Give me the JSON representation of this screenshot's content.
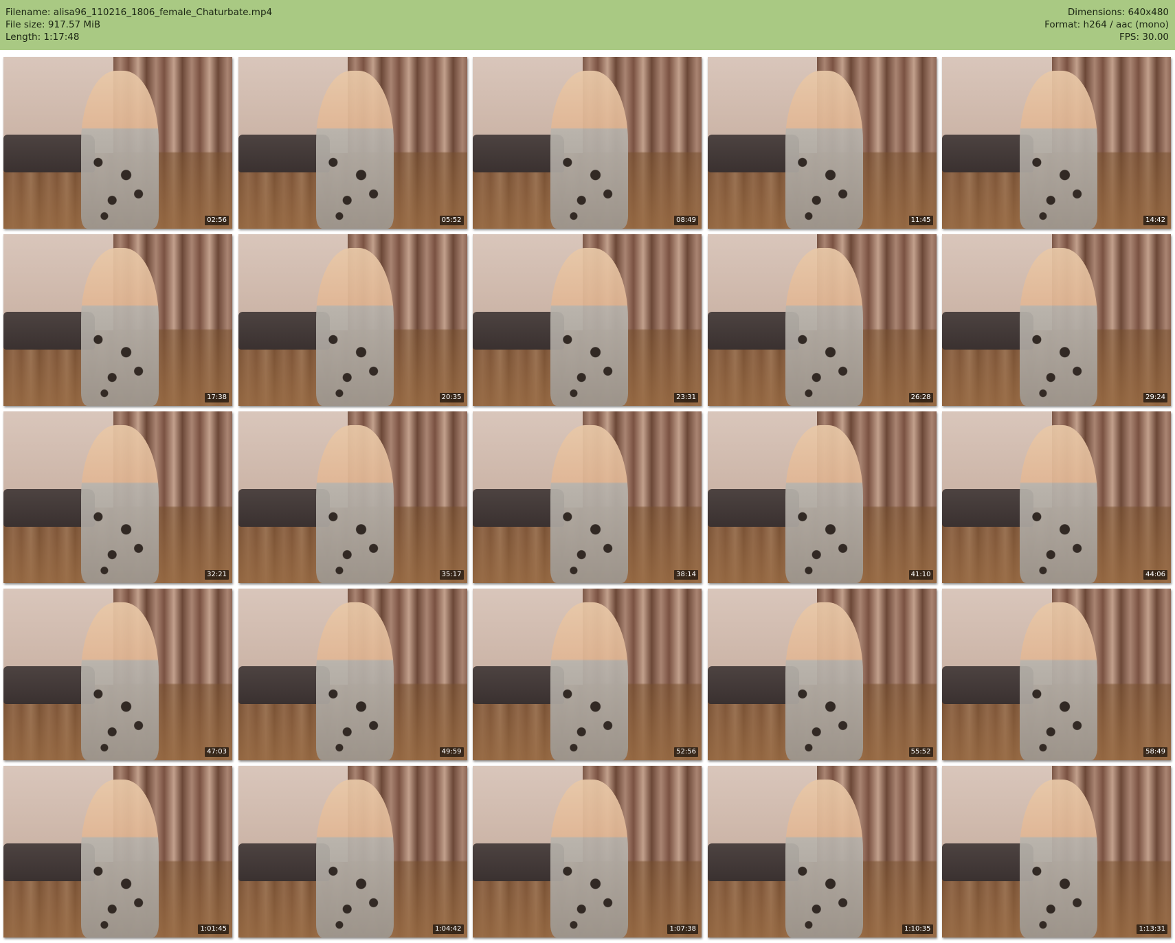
{
  "header": {
    "left": [
      "Filename: alisa96_110216_1806_female_Chaturbate.mp4",
      "File size: 917.57 MiB",
      "Length: 1:17:48"
    ],
    "right": [
      "Dimensions: 640x480",
      "Format: h264 / aac (mono)",
      "FPS: 30.00"
    ]
  },
  "thumbnails": [
    {
      "time": "02:56"
    },
    {
      "time": "05:52"
    },
    {
      "time": "08:49"
    },
    {
      "time": "11:45"
    },
    {
      "time": "14:42"
    },
    {
      "time": "17:38"
    },
    {
      "time": "20:35"
    },
    {
      "time": "23:31"
    },
    {
      "time": "26:28"
    },
    {
      "time": "29:24"
    },
    {
      "time": "32:21"
    },
    {
      "time": "35:17"
    },
    {
      "time": "38:14"
    },
    {
      "time": "41:10"
    },
    {
      "time": "44:06"
    },
    {
      "time": "47:03"
    },
    {
      "time": "49:59"
    },
    {
      "time": "52:56"
    },
    {
      "time": "55:52"
    },
    {
      "time": "58:49"
    },
    {
      "time": "1:01:45"
    },
    {
      "time": "1:04:42"
    },
    {
      "time": "1:07:38"
    },
    {
      "time": "1:10:35"
    },
    {
      "time": "1:13:31"
    }
  ],
  "colors": {
    "header_bg": "#a9c983",
    "header_text": "#1c2614"
  }
}
